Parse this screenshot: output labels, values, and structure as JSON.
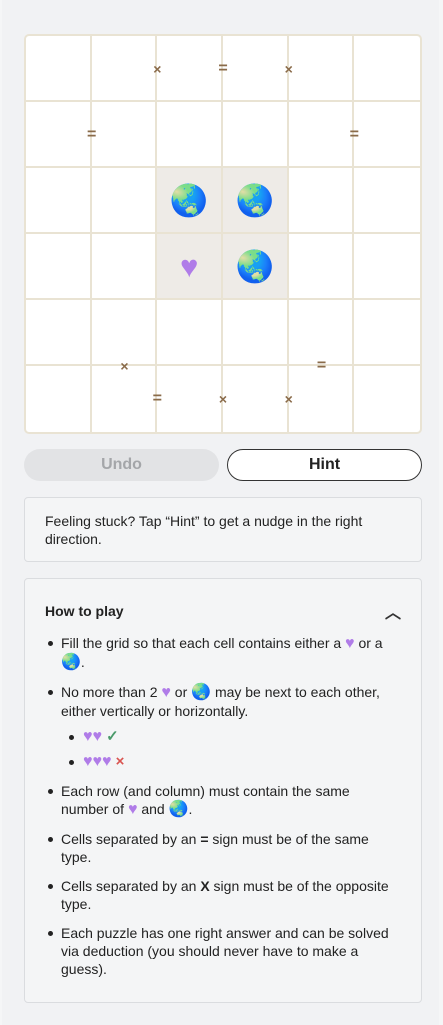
{
  "board": {
    "rows": 6,
    "cols": 6,
    "cells": [
      [
        "",
        "",
        "",
        "",
        "",
        ""
      ],
      [
        "",
        "",
        "",
        "",
        "",
        ""
      ],
      [
        "",
        "",
        "earth",
        "earth",
        "",
        ""
      ],
      [
        "",
        "",
        "heart",
        "earth",
        "",
        ""
      ],
      [
        "",
        "",
        "",
        "",
        "",
        ""
      ],
      [
        "",
        "",
        "",
        "",
        "",
        ""
      ]
    ],
    "locked": [
      [
        2,
        2
      ],
      [
        2,
        3
      ],
      [
        3,
        2
      ],
      [
        3,
        3
      ]
    ],
    "constraints": [
      {
        "type": "x",
        "r1": 0,
        "c1": 1,
        "r2": 0,
        "c2": 2
      },
      {
        "type": "=",
        "r1": 0,
        "c1": 2,
        "r2": 0,
        "c2": 3
      },
      {
        "type": "x",
        "r1": 0,
        "c1": 3,
        "r2": 0,
        "c2": 4
      },
      {
        "type": "=",
        "r1": 1,
        "c1": 0,
        "r2": 1,
        "c2": 1
      },
      {
        "type": "=",
        "r1": 1,
        "c1": 4,
        "r2": 1,
        "c2": 5
      },
      {
        "type": "x",
        "r1": 4,
        "c1": 1,
        "r2": 5,
        "c2": 1
      },
      {
        "type": "=",
        "r1": 4,
        "c1": 4,
        "r2": 5,
        "c2": 4
      },
      {
        "type": "=",
        "r1": 5,
        "c1": 1,
        "r2": 5,
        "c2": 2
      },
      {
        "type": "x",
        "r1": 5,
        "c1": 2,
        "r2": 5,
        "c2": 3
      },
      {
        "type": "x",
        "r1": 5,
        "c1": 3,
        "r2": 5,
        "c2": 4
      }
    ],
    "symbols": {
      "heart": "♥",
      "earth": "🌏",
      "x": "×",
      "=": "="
    }
  },
  "buttons": {
    "undo": "Undo",
    "hint": "Hint"
  },
  "stuck_message": "Feeling stuck? Tap “Hint” to get a nudge in the right direction.",
  "howto": {
    "title": "How to play",
    "rule1_a": "Fill the grid so that each cell contains either a",
    "rule1_b": "or a",
    "rule1_c": ".",
    "rule2_a": "No more than 2",
    "rule2_b": "or",
    "rule2_c": "may be next to each other, either vertically or horizontally.",
    "ok_mark": "✓",
    "bad_mark": "×",
    "rule3_a": "Each row (and column) must contain the same number of",
    "rule3_b": "and",
    "rule3_c": ".",
    "rule4_a": "Cells separated by an",
    "rule4_sign": "=",
    "rule4_b": "sign must be of the same type.",
    "rule5_a": "Cells separated by an",
    "rule5_sign": "X",
    "rule5_b": "sign must be of the opposite type.",
    "rule6": "Each puzzle has one right answer and can be solved via deduction (you should never have to make a guess)."
  },
  "colors": {
    "heart": "#b07ce8",
    "grid_line": "#e9e3d3",
    "locked_bg": "#eeebe7",
    "constraint": "#8a6b4a",
    "ok": "#4a9a6a",
    "bad": "#d9534f"
  }
}
